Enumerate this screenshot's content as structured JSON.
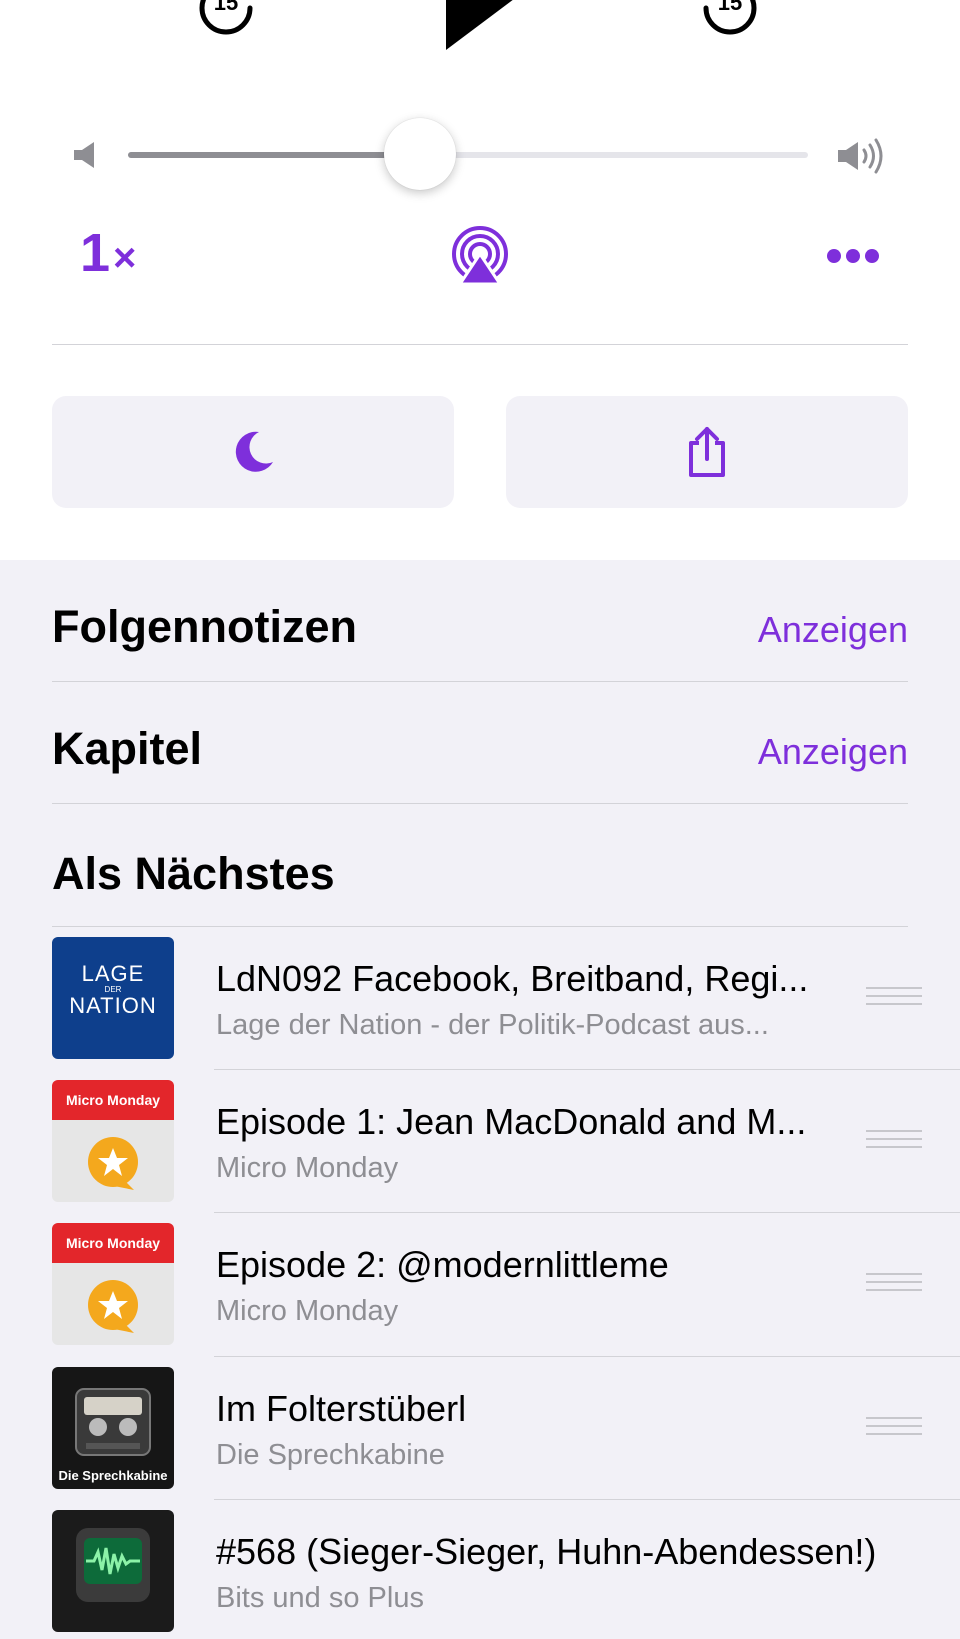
{
  "player": {
    "skip_back_seconds": "15",
    "skip_forward_seconds": "15",
    "volume_level": 0.43,
    "speed_value": "1",
    "speed_suffix": "×",
    "accent_color": "#7e2fdb"
  },
  "icons": {
    "skip_back": "backward-15-icon",
    "play": "play-icon",
    "skip_forward": "forward-15-icon",
    "volume_low": "speaker-low-icon",
    "volume_high": "speaker-high-icon",
    "airplay": "airplay-audio-icon",
    "more": "ellipsis-icon",
    "sleep_timer": "moon-icon",
    "share": "share-icon",
    "reorder": "grabber-icon"
  },
  "sections": {
    "notes": {
      "title": "Folgennotizen",
      "action": "Anzeigen"
    },
    "chapters": {
      "title": "Kapitel",
      "action": "Anzeigen"
    },
    "up_next": {
      "title": "Als Nächstes"
    }
  },
  "queue": [
    {
      "title": "LdN092 Facebook, Breitband, Regi...",
      "subtitle": "Lage der Nation - der Politik-Podcast aus...",
      "art_text_1": "LAGE",
      "art_text_2": "DER",
      "art_text_3": "NATION"
    },
    {
      "title": "Episode 1: Jean MacDonald and M...",
      "subtitle": "Micro Monday",
      "art_text": "Micro Monday"
    },
    {
      "title": "Episode 2: @modernlittleme",
      "subtitle": "Micro Monday",
      "art_text": "Micro Monday"
    },
    {
      "title": "Im Folterstüberl",
      "subtitle": "Die Sprechkabine",
      "art_text": "Die Sprechkabine"
    },
    {
      "title": "#568 (Sieger-Sieger, Huhn-Abendessen!)",
      "subtitle": "Bits und so Plus"
    }
  ]
}
